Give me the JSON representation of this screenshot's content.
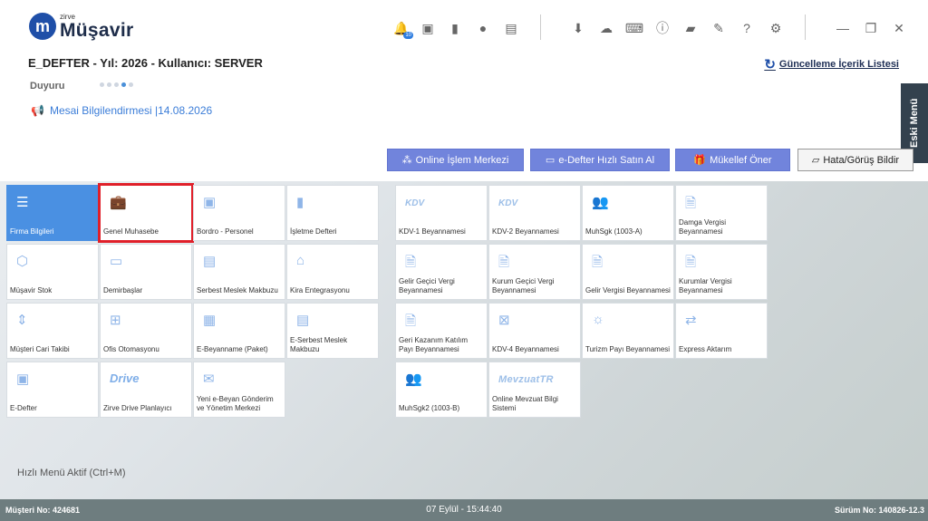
{
  "app": {
    "logo_small": "zirve",
    "logo_big": "Müşavir"
  },
  "header": {
    "notification_count": "10",
    "title": "E_DEFTER - Yıl: 2026 - Kullanıcı: SERVER",
    "updates_link": "Güncelleme İçerik Listesi",
    "announcements_label": "Duyuru",
    "message": "Mesai Bilgilendirmesi |14.08.2026",
    "old_menu": "Eski Menü"
  },
  "actions": {
    "online": "Online İşlem Merkezi",
    "edefter_buy": "e-Defter Hızlı Satın Al",
    "recommend": "Mükellef Öner",
    "feedback": "Hata/Görüş Bildir"
  },
  "tiles_left": [
    [
      "Firma Bilgileri",
      "Genel Muhasebe",
      "Bordro - Personel",
      "İşletme Defteri"
    ],
    [
      "Müşavir Stok",
      "Demirbaşlar",
      "Serbest Meslek Makbuzu",
      "Kira Entegrasyonu"
    ],
    [
      "Müşteri Cari Takibi",
      "Ofis Otomasyonu",
      "E-Beyanname (Paket)",
      "E-Serbest Meslek Makbuzu"
    ],
    [
      "E-Defter",
      "Zirve Drive Planlayıcı",
      "Yeni e-Beyan Gönderim ve Yönetim Merkezi"
    ]
  ],
  "tiles_right": [
    [
      "KDV-1 Beyannamesi",
      "KDV-2 Beyannamesi",
      "MuhSgk (1003-A)",
      "Damga Vergisi Beyannamesi"
    ],
    [
      "Gelir Geçici Vergi Beyannamesi",
      "Kurum Geçici Vergi Beyannamesi",
      "Gelir Vergisi Beyannamesi",
      "Kurumlar Vergisi Beyannamesi"
    ],
    [
      "Geri Kazanım Katılım Payı Beyannamesi",
      "KDV-4 Beyannamesi",
      "Turizm Payı Beyannamesi",
      "Express Aktarım"
    ],
    [
      "MuhSgk2 (1003-B)",
      "Online Mevzuat Bilgi Sistemi"
    ]
  ],
  "tile_logos": {
    "kdv": "KDV",
    "drive": "Drive",
    "drive_small": "zirve",
    "mevzuat": "MevzuatTR"
  },
  "footer": {
    "quick_menu": "Hızlı Menü Aktif (Ctrl+M)",
    "customer_no": "Müşteri No: 424681",
    "datetime": "07 Eylül - 15:44:40",
    "version": "Sürüm No: 140826-12.3"
  },
  "colors": {
    "accent": "#7184dc",
    "tile_blue": "#4a90e2",
    "selected": "#e0202a",
    "statusbar": "#6e7d7f"
  }
}
